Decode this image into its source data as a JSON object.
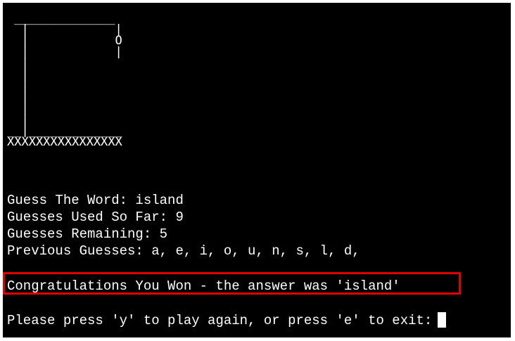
{
  "terminal": {
    "gallows_art": " ______________\n  |            |\n  |            O\n  |            |\n  |\n  |\n  |\n  |\n  |\n  |\n__|_____________\nXXXXXXXXXXXXXXXX",
    "guess_word_line": "Guess The Word: island",
    "guesses_used_line": "Guesses Used So Far: 9",
    "guesses_remaining_line": "Guesses Remaining: 5",
    "previous_guesses_line": "Previous Guesses: a, e, i, o, u, n, s, l, d,",
    "win_message": "Congratulations You Won - the answer was 'island'",
    "prompt": "Please press 'y' to play again, or press 'e' to exit:"
  },
  "colors": {
    "background": "#000000",
    "text": "#ffffff",
    "highlight_border": "#e00000"
  }
}
